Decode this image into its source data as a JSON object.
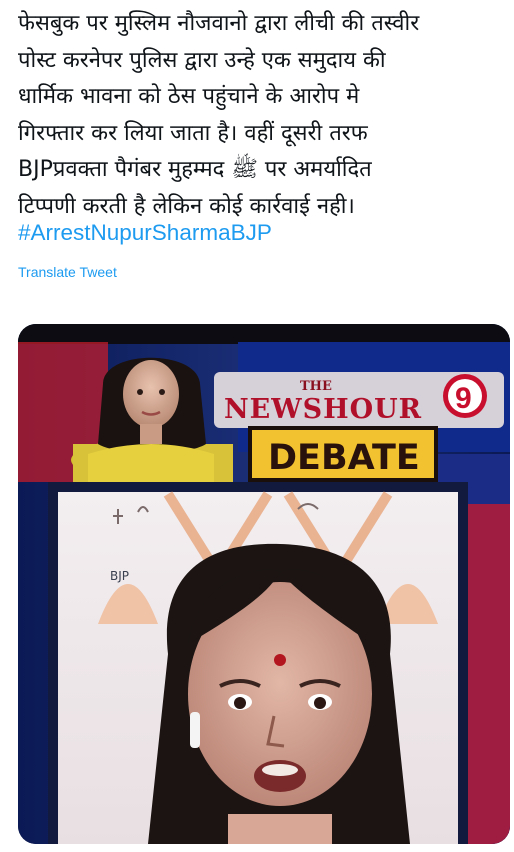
{
  "tweet": {
    "lines": [
      "फेसबुक पर मुस्लिम नौजवानो द्वारा लीची की तस्वीर",
      "पोस्ट करनेपर पुलिस द्वारा उन्हे एक समुदाय की",
      "धार्मिक भावना को ठेस पहुंचाने के आरोप मे",
      "गिरफ्तार कर लिया जाता है। वहीं दूसरी तरफ",
      "BJPप्रवक्ता पैगंबर मुहम्मद ﷺ पर अमर्यादित",
      "टिप्पणी करती है लेकिन कोई कार्रवाई नही।"
    ],
    "hashtag": "#ArrestNupurSharmaBJP",
    "translate_label": "Translate Tweet"
  },
  "media": {
    "logo_the": "THE",
    "logo_main": "NEWSHOUR",
    "logo_number": "9",
    "banner": "DEBATE",
    "party_label": "BJP",
    "colors": {
      "accent": "#1d9bf0",
      "logo_red": "#c8102e",
      "banner_yellow": "#f2c230",
      "studio_blue": "#1b2f78"
    }
  }
}
